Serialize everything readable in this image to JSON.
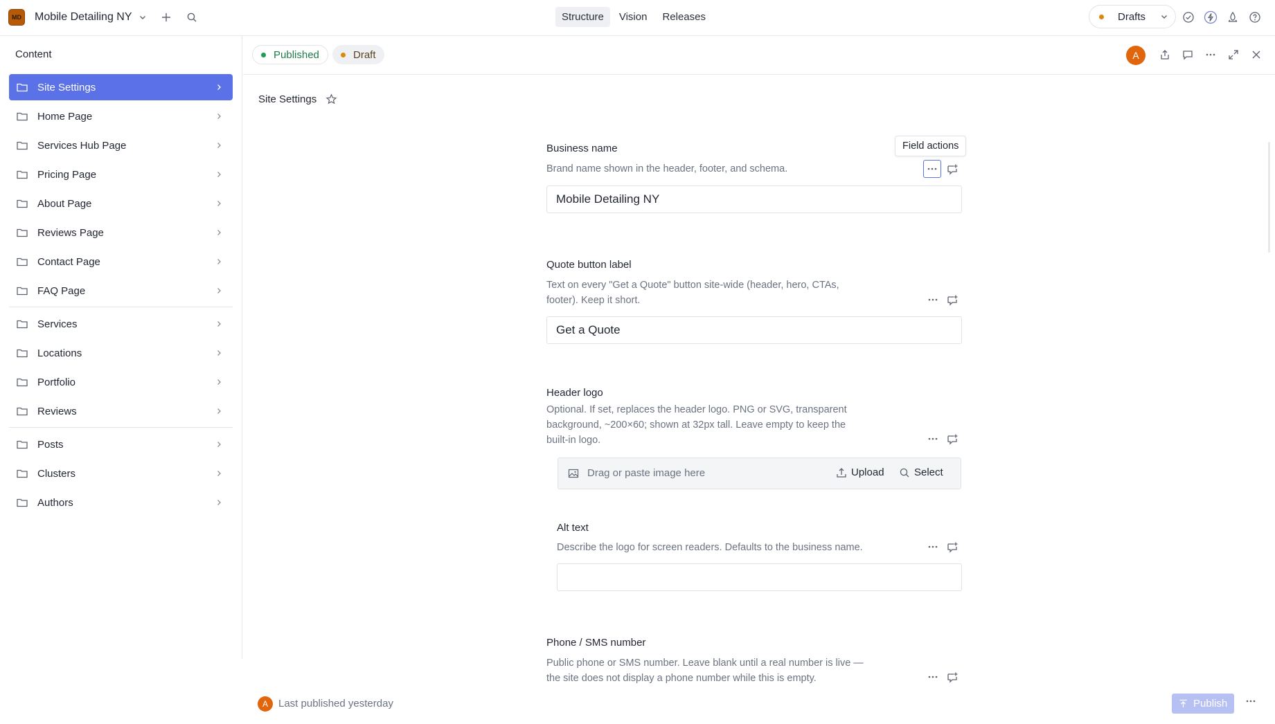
{
  "workspace": {
    "badge": "MD",
    "name": "Mobile Detailing NY"
  },
  "nav": {
    "tabs": [
      "Structure",
      "Vision",
      "Releases"
    ]
  },
  "perspective": {
    "label": "Drafts"
  },
  "sidebar": {
    "title": "Content",
    "items": [
      {
        "label": "Site Settings"
      },
      {
        "label": "Home Page"
      },
      {
        "label": "Services Hub Page"
      },
      {
        "label": "Pricing Page"
      },
      {
        "label": "About Page"
      },
      {
        "label": "Reviews Page"
      },
      {
        "label": "Contact Page"
      },
      {
        "label": "FAQ Page"
      },
      {
        "label": "Services"
      },
      {
        "label": "Locations"
      },
      {
        "label": "Portfolio"
      },
      {
        "label": "Reviews"
      },
      {
        "label": "Posts"
      },
      {
        "label": "Clusters"
      },
      {
        "label": "Authors"
      }
    ]
  },
  "doc_header": {
    "published": "Published",
    "draft": "Draft",
    "avatar": "A"
  },
  "document": {
    "title": "Site Settings",
    "tooltip": "Field actions",
    "fields": {
      "business_name": {
        "title": "Business name",
        "desc": "Brand name shown in the header, footer, and schema.",
        "value": "Mobile Detailing NY"
      },
      "quote_label": {
        "title": "Quote button label",
        "desc1": "Text on every \"Get a Quote\" button site-wide (header, hero, CTAs,",
        "desc2": "footer). Keep it short.",
        "value": "Get a Quote"
      },
      "header_logo": {
        "title": "Header logo",
        "desc1": "Optional. If set, replaces the header logo. PNG or SVG, transparent",
        "desc2": "background, ~200×60; shown at 32px tall. Leave empty to keep the",
        "desc3": "built-in logo.",
        "placeholder": "Drag or paste image here",
        "upload": "Upload",
        "select": "Select"
      },
      "alt_text": {
        "title": "Alt text",
        "desc": "Describe the logo for screen readers. Defaults to the business name.",
        "value": ""
      },
      "phone": {
        "title": "Phone / SMS number",
        "desc1": "Public phone or SMS number. Leave blank until a real number is live —",
        "desc2": "the site does not display a phone number while this is empty."
      }
    }
  },
  "footer": {
    "avatar": "A",
    "status": "Last published yesterday",
    "publish": "Publish"
  },
  "colors": {
    "accent": "#5b71e8",
    "published_dot": "#1f9d55",
    "draft_dot": "#d98a0b",
    "avatar": "#e0650c"
  }
}
